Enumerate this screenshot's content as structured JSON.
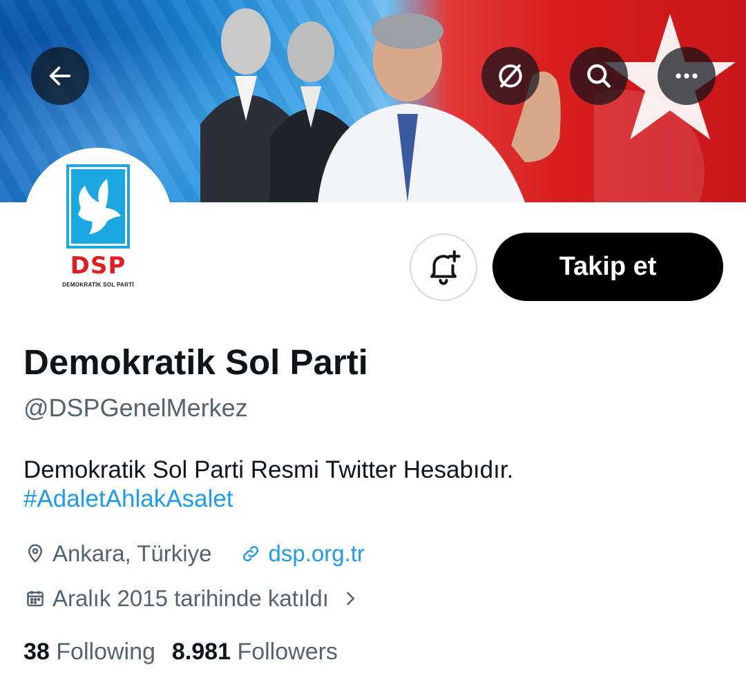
{
  "header": {
    "back_icon": "arrow-left-icon",
    "translate_icon": "no-translate-icon",
    "search_icon": "search-icon",
    "more_icon": "more-dots-icon"
  },
  "avatar": {
    "logo_text": "DSP",
    "logo_subtext": "DEMOKRATİK SOL PARTİ"
  },
  "actions": {
    "notify_icon": "bell-plus-icon",
    "follow_label": "Takip et"
  },
  "profile": {
    "display_name": "Demokratik Sol Parti",
    "handle": "@DSPGenelMerkez",
    "bio": "Demokratik Sol Parti Resmi Twitter Hesabıdır.",
    "bio_hashtag": "#AdaletAhlakAsalet",
    "location": "Ankara, Türkiye",
    "website": "dsp.org.tr",
    "joined": "Aralık 2015 tarihinde katıldı"
  },
  "stats": {
    "following_count": "38",
    "following_label": "Following",
    "followers_count": "8.981",
    "followers_label": "Followers"
  },
  "colors": {
    "accent": "#1d9bf0",
    "secondary_text": "#536471",
    "primary_text": "#0f1419",
    "logo_blue": "#1ba7df",
    "logo_red": "#e01e25"
  }
}
